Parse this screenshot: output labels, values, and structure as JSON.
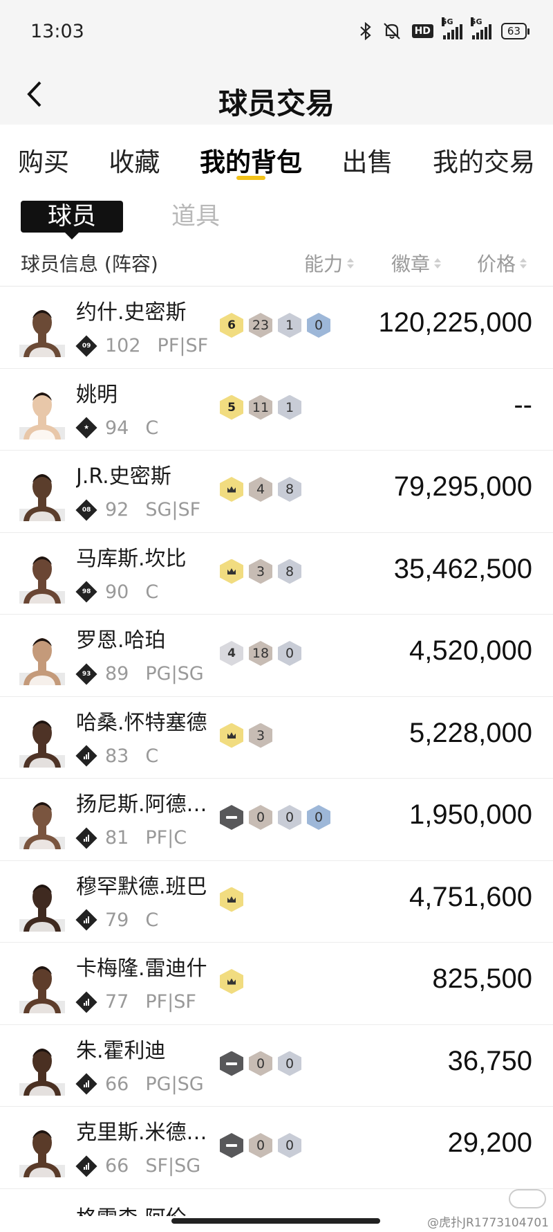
{
  "status": {
    "time": "13:03",
    "battery": "63",
    "net1": "5G",
    "net2": "5G",
    "hd": "HD"
  },
  "header": {
    "title": "球员交易"
  },
  "tabs": [
    {
      "label": "购买"
    },
    {
      "label": "收藏"
    },
    {
      "label": "我的背包",
      "active": true
    },
    {
      "label": "出售"
    },
    {
      "label": "我的交易"
    }
  ],
  "subtabs": {
    "players": "球员",
    "items": "道具"
  },
  "columns": {
    "info": "球员信息 (阵容)",
    "ability": "能力",
    "badges": "徽章",
    "price": "价格"
  },
  "players": [
    {
      "name": "约什.史密斯",
      "tier": "09",
      "ovr": "102",
      "pos": "PF|SF",
      "price": "120,225,000",
      "badges": [
        {
          "t": "y",
          "v": "6"
        },
        {
          "t": "br",
          "v": "23"
        },
        {
          "t": "sl",
          "v": "1"
        },
        {
          "t": "bl",
          "v": "0"
        }
      ]
    },
    {
      "name": "姚明",
      "tier": "★",
      "ovr": "94",
      "pos": "C",
      "price": "--",
      "badges": [
        {
          "t": "y",
          "v": "5"
        },
        {
          "t": "br",
          "v": "11"
        },
        {
          "t": "sl",
          "v": "1"
        }
      ]
    },
    {
      "name": "J.R.史密斯",
      "tier": "08",
      "ovr": "92",
      "pos": "SG|SF",
      "price": "79,295,000",
      "badges": [
        {
          "t": "crown",
          "v": ""
        },
        {
          "t": "br",
          "v": "4"
        },
        {
          "t": "sl",
          "v": "8"
        }
      ]
    },
    {
      "name": "马库斯.坎比",
      "tier": "98",
      "ovr": "90",
      "pos": "C",
      "price": "35,462,500",
      "badges": [
        {
          "t": "crown",
          "v": ""
        },
        {
          "t": "br",
          "v": "3"
        },
        {
          "t": "sl",
          "v": "8"
        }
      ]
    },
    {
      "name": "罗恩.哈珀",
      "tier": "93",
      "ovr": "89",
      "pos": "PG|SG",
      "price": "4,520,000",
      "badges": [
        {
          "t": "w",
          "v": "4"
        },
        {
          "t": "br",
          "v": "18"
        },
        {
          "t": "sl",
          "v": "0"
        }
      ]
    },
    {
      "name": "哈桑.怀特塞德",
      "tier": "bars",
      "ovr": "83",
      "pos": "C",
      "price": "5,228,000",
      "badges": [
        {
          "t": "crown",
          "v": ""
        },
        {
          "t": "br",
          "v": "3"
        }
      ]
    },
    {
      "name": "扬尼斯.阿德…",
      "tier": "bars",
      "ovr": "81",
      "pos": "PF|C",
      "price": "1,950,000",
      "badges": [
        {
          "t": "k",
          "v": ""
        },
        {
          "t": "br",
          "v": "0"
        },
        {
          "t": "sl",
          "v": "0"
        },
        {
          "t": "bl",
          "v": "0"
        }
      ]
    },
    {
      "name": "穆罕默德.班巴",
      "tier": "bars",
      "ovr": "79",
      "pos": "C",
      "price": "4,751,600",
      "badges": [
        {
          "t": "crown",
          "v": ""
        }
      ]
    },
    {
      "name": "卡梅隆.雷迪什",
      "tier": "bars",
      "ovr": "77",
      "pos": "PF|SF",
      "price": "825,500",
      "badges": [
        {
          "t": "crown",
          "v": ""
        }
      ]
    },
    {
      "name": "朱.霍利迪",
      "tier": "bars",
      "ovr": "66",
      "pos": "PG|SG",
      "price": "36,750",
      "badges": [
        {
          "t": "k",
          "v": ""
        },
        {
          "t": "br",
          "v": "0"
        },
        {
          "t": "sl",
          "v": "0"
        }
      ]
    },
    {
      "name": "克里斯.米德…",
      "tier": "bars",
      "ovr": "66",
      "pos": "SF|SG",
      "price": "29,200",
      "badges": [
        {
          "t": "k",
          "v": ""
        },
        {
          "t": "br",
          "v": "0"
        },
        {
          "t": "sl",
          "v": "0"
        }
      ]
    }
  ],
  "partial_row": {
    "name": "格雷森.阿伦"
  },
  "watermark": "@虎扑JR1773104701",
  "colors": {
    "accent": "#f2c21a",
    "badge_gold": "#f1dc80",
    "badge_bronze": "#c7bcb4",
    "badge_silver": "#c8ccd6",
    "badge_blue": "#9db7d8"
  }
}
